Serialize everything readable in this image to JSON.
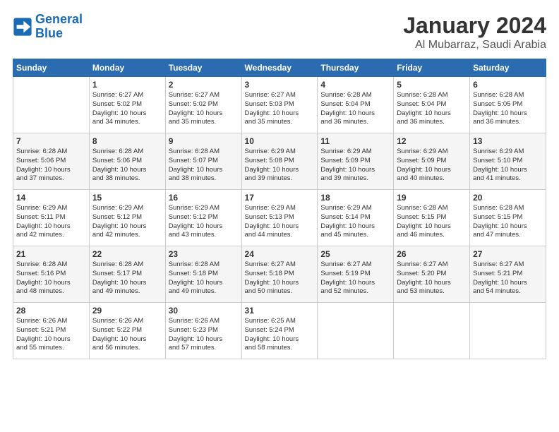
{
  "header": {
    "logo_line1": "General",
    "logo_line2": "Blue",
    "month": "January 2024",
    "location": "Al Mubarraz, Saudi Arabia"
  },
  "weekdays": [
    "Sunday",
    "Monday",
    "Tuesday",
    "Wednesday",
    "Thursday",
    "Friday",
    "Saturday"
  ],
  "weeks": [
    [
      {
        "day": "",
        "info": ""
      },
      {
        "day": "1",
        "info": "Sunrise: 6:27 AM\nSunset: 5:02 PM\nDaylight: 10 hours\nand 34 minutes."
      },
      {
        "day": "2",
        "info": "Sunrise: 6:27 AM\nSunset: 5:02 PM\nDaylight: 10 hours\nand 35 minutes."
      },
      {
        "day": "3",
        "info": "Sunrise: 6:27 AM\nSunset: 5:03 PM\nDaylight: 10 hours\nand 35 minutes."
      },
      {
        "day": "4",
        "info": "Sunrise: 6:28 AM\nSunset: 5:04 PM\nDaylight: 10 hours\nand 36 minutes."
      },
      {
        "day": "5",
        "info": "Sunrise: 6:28 AM\nSunset: 5:04 PM\nDaylight: 10 hours\nand 36 minutes."
      },
      {
        "day": "6",
        "info": "Sunrise: 6:28 AM\nSunset: 5:05 PM\nDaylight: 10 hours\nand 36 minutes."
      }
    ],
    [
      {
        "day": "7",
        "info": "Sunrise: 6:28 AM\nSunset: 5:06 PM\nDaylight: 10 hours\nand 37 minutes."
      },
      {
        "day": "8",
        "info": "Sunrise: 6:28 AM\nSunset: 5:06 PM\nDaylight: 10 hours\nand 38 minutes."
      },
      {
        "day": "9",
        "info": "Sunrise: 6:28 AM\nSunset: 5:07 PM\nDaylight: 10 hours\nand 38 minutes."
      },
      {
        "day": "10",
        "info": "Sunrise: 6:29 AM\nSunset: 5:08 PM\nDaylight: 10 hours\nand 39 minutes."
      },
      {
        "day": "11",
        "info": "Sunrise: 6:29 AM\nSunset: 5:09 PM\nDaylight: 10 hours\nand 39 minutes."
      },
      {
        "day": "12",
        "info": "Sunrise: 6:29 AM\nSunset: 5:09 PM\nDaylight: 10 hours\nand 40 minutes."
      },
      {
        "day": "13",
        "info": "Sunrise: 6:29 AM\nSunset: 5:10 PM\nDaylight: 10 hours\nand 41 minutes."
      }
    ],
    [
      {
        "day": "14",
        "info": "Sunrise: 6:29 AM\nSunset: 5:11 PM\nDaylight: 10 hours\nand 42 minutes."
      },
      {
        "day": "15",
        "info": "Sunrise: 6:29 AM\nSunset: 5:12 PM\nDaylight: 10 hours\nand 42 minutes."
      },
      {
        "day": "16",
        "info": "Sunrise: 6:29 AM\nSunset: 5:12 PM\nDaylight: 10 hours\nand 43 minutes."
      },
      {
        "day": "17",
        "info": "Sunrise: 6:29 AM\nSunset: 5:13 PM\nDaylight: 10 hours\nand 44 minutes."
      },
      {
        "day": "18",
        "info": "Sunrise: 6:29 AM\nSunset: 5:14 PM\nDaylight: 10 hours\nand 45 minutes."
      },
      {
        "day": "19",
        "info": "Sunrise: 6:28 AM\nSunset: 5:15 PM\nDaylight: 10 hours\nand 46 minutes."
      },
      {
        "day": "20",
        "info": "Sunrise: 6:28 AM\nSunset: 5:15 PM\nDaylight: 10 hours\nand 47 minutes."
      }
    ],
    [
      {
        "day": "21",
        "info": "Sunrise: 6:28 AM\nSunset: 5:16 PM\nDaylight: 10 hours\nand 48 minutes."
      },
      {
        "day": "22",
        "info": "Sunrise: 6:28 AM\nSunset: 5:17 PM\nDaylight: 10 hours\nand 49 minutes."
      },
      {
        "day": "23",
        "info": "Sunrise: 6:28 AM\nSunset: 5:18 PM\nDaylight: 10 hours\nand 49 minutes."
      },
      {
        "day": "24",
        "info": "Sunrise: 6:27 AM\nSunset: 5:18 PM\nDaylight: 10 hours\nand 50 minutes."
      },
      {
        "day": "25",
        "info": "Sunrise: 6:27 AM\nSunset: 5:19 PM\nDaylight: 10 hours\nand 52 minutes."
      },
      {
        "day": "26",
        "info": "Sunrise: 6:27 AM\nSunset: 5:20 PM\nDaylight: 10 hours\nand 53 minutes."
      },
      {
        "day": "27",
        "info": "Sunrise: 6:27 AM\nSunset: 5:21 PM\nDaylight: 10 hours\nand 54 minutes."
      }
    ],
    [
      {
        "day": "28",
        "info": "Sunrise: 6:26 AM\nSunset: 5:21 PM\nDaylight: 10 hours\nand 55 minutes."
      },
      {
        "day": "29",
        "info": "Sunrise: 6:26 AM\nSunset: 5:22 PM\nDaylight: 10 hours\nand 56 minutes."
      },
      {
        "day": "30",
        "info": "Sunrise: 6:26 AM\nSunset: 5:23 PM\nDaylight: 10 hours\nand 57 minutes."
      },
      {
        "day": "31",
        "info": "Sunrise: 6:25 AM\nSunset: 5:24 PM\nDaylight: 10 hours\nand 58 minutes."
      },
      {
        "day": "",
        "info": ""
      },
      {
        "day": "",
        "info": ""
      },
      {
        "day": "",
        "info": ""
      }
    ]
  ]
}
